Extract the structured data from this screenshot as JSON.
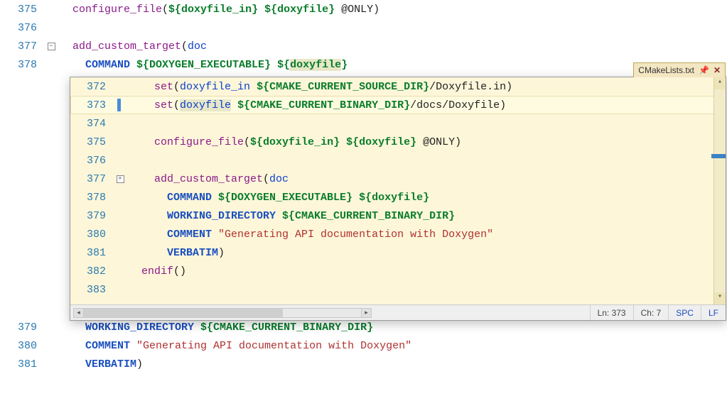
{
  "bg": {
    "lines": [
      {
        "num": 375,
        "fold": "line",
        "spans": [
          {
            "indent": 1
          },
          {
            "t": "configure_file",
            "c": "fn"
          },
          {
            "t": "(",
            "c": "plain"
          },
          {
            "t": "${doxyfile_in}",
            "c": "varexp"
          },
          {
            "t": " ",
            "c": "plain"
          },
          {
            "t": "${doxyfile}",
            "c": "varexp"
          },
          {
            "t": " @ONLY)",
            "c": "plain"
          }
        ]
      },
      {
        "num": 376,
        "fold": "line",
        "spans": []
      },
      {
        "num": 377,
        "fold": "box-minus",
        "spans": [
          {
            "indent": 1
          },
          {
            "t": "add_custom_target",
            "c": "fn"
          },
          {
            "t": "(",
            "c": "plain"
          },
          {
            "t": "doc",
            "c": "var"
          }
        ]
      },
      {
        "num": 378,
        "fold": "line",
        "spans": [
          {
            "indent": 2
          },
          {
            "t": "COMMAND",
            "c": "kw"
          },
          {
            "t": " ",
            "c": "plain"
          },
          {
            "t": "${DOXYGEN_EXECUTABLE}",
            "c": "varexp"
          },
          {
            "t": " ",
            "c": "plain"
          },
          {
            "t": "${",
            "c": "varexp"
          },
          {
            "t": "doxyfile",
            "c": "varexp",
            "hl": true
          },
          {
            "t": "}",
            "c": "varexp"
          }
        ]
      }
    ],
    "lines_below": [
      {
        "num": 379,
        "fold": "line",
        "spans": [
          {
            "indent": 2
          },
          {
            "t": "WORKING_DIRECTORY",
            "c": "kw"
          },
          {
            "t": " ",
            "c": "plain"
          },
          {
            "t": "${CMAKE_CURRENT_BINARY_DIR}",
            "c": "varexp"
          }
        ]
      },
      {
        "num": 380,
        "fold": "line",
        "spans": [
          {
            "indent": 2
          },
          {
            "t": "COMMENT",
            "c": "kw"
          },
          {
            "t": " ",
            "c": "plain"
          },
          {
            "t": "\"Generating API documentation with Doxygen\"",
            "c": "str"
          }
        ]
      },
      {
        "num": 381,
        "fold": "line",
        "spans": [
          {
            "indent": 2
          },
          {
            "t": "VERBATIM",
            "c": "kw"
          },
          {
            "t": ")",
            "c": "plain"
          }
        ]
      }
    ]
  },
  "popup": {
    "tab_title": "CMakeLists.txt",
    "current_line_idx": 1,
    "right_marker_top_px": 108,
    "status": {
      "ln": "Ln: 373",
      "ch": "Ch: 7",
      "spc": "SPC",
      "lf": "LF"
    },
    "lines": [
      {
        "num": 372,
        "spans": [
          {
            "indent": 2
          },
          {
            "t": "set",
            "c": "fn"
          },
          {
            "t": "(",
            "c": "plain"
          },
          {
            "t": "doxyfile_in",
            "c": "var"
          },
          {
            "t": " ",
            "c": "plain"
          },
          {
            "t": "${CMAKE_CURRENT_SOURCE_DIR}",
            "c": "varexp"
          },
          {
            "t": "/Doxyfile.in)",
            "c": "plain"
          }
        ]
      },
      {
        "num": 373,
        "spans": [
          {
            "indent": 2
          },
          {
            "t": "set",
            "c": "fn"
          },
          {
            "t": "(",
            "c": "plain"
          },
          {
            "t": "doxyfile",
            "c": "var",
            "hl": true
          },
          {
            "t": " ",
            "c": "plain"
          },
          {
            "t": "${CMAKE_CURRENT_BINARY_DIR}",
            "c": "varexp"
          },
          {
            "t": "/docs/Doxyfile)",
            "c": "plain"
          }
        ]
      },
      {
        "num": 374,
        "spans": []
      },
      {
        "num": 375,
        "spans": [
          {
            "indent": 2
          },
          {
            "t": "configure_file",
            "c": "fn"
          },
          {
            "t": "(",
            "c": "plain"
          },
          {
            "t": "${doxyfile_in}",
            "c": "varexp"
          },
          {
            "t": " ",
            "c": "plain"
          },
          {
            "t": "${doxyfile}",
            "c": "varexp"
          },
          {
            "t": " @ONLY)",
            "c": "plain"
          }
        ]
      },
      {
        "num": 376,
        "spans": []
      },
      {
        "num": 377,
        "fold": "box-plus",
        "spans": [
          {
            "indent": 2
          },
          {
            "t": "add_custom_target",
            "c": "fn"
          },
          {
            "t": "(",
            "c": "plain"
          },
          {
            "t": "doc",
            "c": "var"
          }
        ]
      },
      {
        "num": 378,
        "spans": [
          {
            "indent": 3
          },
          {
            "t": "COMMAND",
            "c": "kw"
          },
          {
            "t": " ",
            "c": "plain"
          },
          {
            "t": "${DOXYGEN_EXECUTABLE}",
            "c": "varexp"
          },
          {
            "t": " ",
            "c": "plain"
          },
          {
            "t": "${doxyfile}",
            "c": "varexp"
          }
        ]
      },
      {
        "num": 379,
        "spans": [
          {
            "indent": 3
          },
          {
            "t": "WORKING_DIRECTORY",
            "c": "kw"
          },
          {
            "t": " ",
            "c": "plain"
          },
          {
            "t": "${CMAKE_CURRENT_BINARY_DIR}",
            "c": "varexp"
          }
        ]
      },
      {
        "num": 380,
        "spans": [
          {
            "indent": 3
          },
          {
            "t": "COMMENT",
            "c": "kw"
          },
          {
            "t": " ",
            "c": "plain"
          },
          {
            "t": "\"Generating API documentation with Doxygen\"",
            "c": "str"
          }
        ]
      },
      {
        "num": 381,
        "spans": [
          {
            "indent": 3
          },
          {
            "t": "VERBATIM",
            "c": "kw"
          },
          {
            "t": ")",
            "c": "plain"
          }
        ]
      },
      {
        "num": 382,
        "spans": [
          {
            "indent": 1
          },
          {
            "t": "endif",
            "c": "fn"
          },
          {
            "t": "()",
            "c": "plain"
          }
        ]
      },
      {
        "num": 383,
        "spans": []
      }
    ]
  }
}
